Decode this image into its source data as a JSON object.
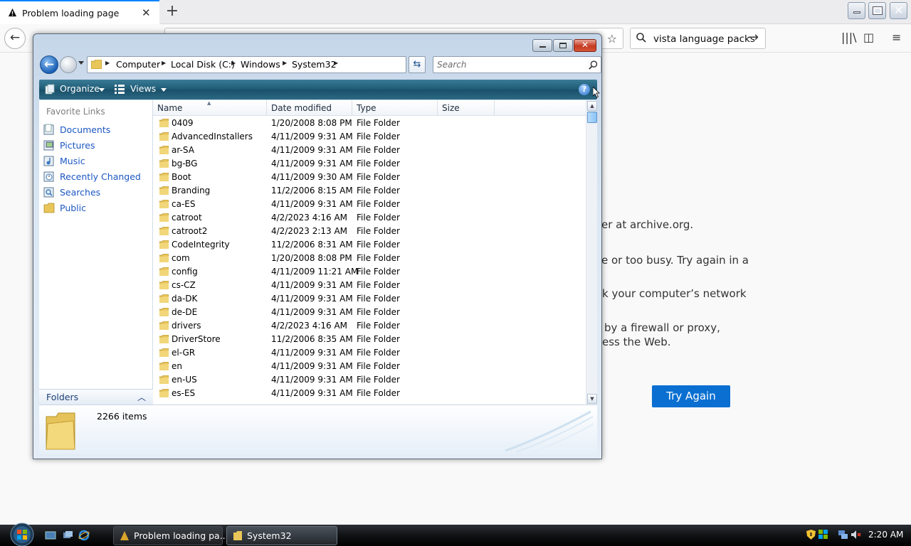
{
  "browser": {
    "tab_title": "Problem loading page",
    "search_value": "vista language packs",
    "error_lines": [
      "er at archive.org.",
      "e or too busy. Try again in a",
      "k your computer’s network",
      "by a firewall or proxy,",
      "ess the Web."
    ],
    "try_again_label": "Try Again"
  },
  "explorer": {
    "breadcrumb": [
      "Computer",
      "Local Disk (C:)",
      "Windows",
      "System32"
    ],
    "search_placeholder": "Search",
    "toolbar": {
      "organize": "Organize",
      "views": "Views"
    },
    "favorite_links_header": "Favorite Links",
    "favorite_links": [
      "Documents",
      "Pictures",
      "Music",
      "Recently Changed",
      "Searches",
      "Public"
    ],
    "folders_label": "Folders",
    "columns": [
      "Name",
      "Date modified",
      "Type",
      "Size"
    ],
    "rows": [
      {
        "name": "0409",
        "date": "1/20/2008 8:08 PM",
        "type": "File Folder"
      },
      {
        "name": "AdvancedInstallers",
        "date": "4/11/2009 9:31 AM",
        "type": "File Folder"
      },
      {
        "name": "ar-SA",
        "date": "4/11/2009 9:31 AM",
        "type": "File Folder"
      },
      {
        "name": "bg-BG",
        "date": "4/11/2009 9:31 AM",
        "type": "File Folder"
      },
      {
        "name": "Boot",
        "date": "4/11/2009 9:30 AM",
        "type": "File Folder"
      },
      {
        "name": "Branding",
        "date": "11/2/2006 8:15 AM",
        "type": "File Folder"
      },
      {
        "name": "ca-ES",
        "date": "4/11/2009 9:31 AM",
        "type": "File Folder"
      },
      {
        "name": "catroot",
        "date": "4/2/2023 4:16 AM",
        "type": "File Folder"
      },
      {
        "name": "catroot2",
        "date": "4/2/2023 2:13 AM",
        "type": "File Folder"
      },
      {
        "name": "CodeIntegrity",
        "date": "11/2/2006 8:31 AM",
        "type": "File Folder"
      },
      {
        "name": "com",
        "date": "1/20/2008 8:08 PM",
        "type": "File Folder"
      },
      {
        "name": "config",
        "date": "4/11/2009 11:21 AM",
        "type": "File Folder"
      },
      {
        "name": "cs-CZ",
        "date": "4/11/2009 9:31 AM",
        "type": "File Folder"
      },
      {
        "name": "da-DK",
        "date": "4/11/2009 9:31 AM",
        "type": "File Folder"
      },
      {
        "name": "de-DE",
        "date": "4/11/2009 9:31 AM",
        "type": "File Folder"
      },
      {
        "name": "drivers",
        "date": "4/2/2023 4:16 AM",
        "type": "File Folder"
      },
      {
        "name": "DriverStore",
        "date": "11/2/2006 8:35 AM",
        "type": "File Folder"
      },
      {
        "name": "el-GR",
        "date": "4/11/2009 9:31 AM",
        "type": "File Folder"
      },
      {
        "name": "en",
        "date": "4/11/2009 9:31 AM",
        "type": "File Folder"
      },
      {
        "name": "en-US",
        "date": "4/11/2009 9:31 AM",
        "type": "File Folder"
      },
      {
        "name": "es-ES",
        "date": "4/11/2009 9:31 AM",
        "type": "File Folder"
      }
    ],
    "item_count": "2266 items"
  },
  "taskbar": {
    "buttons": [
      "Problem loading pa...",
      "System32"
    ],
    "clock": "2:20 AM"
  }
}
